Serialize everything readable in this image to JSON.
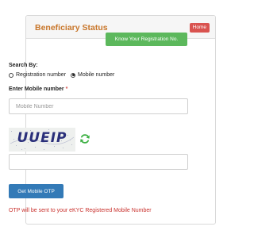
{
  "header": {
    "title": "Beneficiary Status",
    "home_label": "Home"
  },
  "know_registration_label": "Know Your Registration No.",
  "search_by": {
    "label": "Search By:",
    "options": [
      "Registration number",
      "Mobile number"
    ],
    "selected": "Mobile number"
  },
  "mobile": {
    "label": "Enter Mobile number",
    "required_mark": "*",
    "placeholder": "Mobile Number",
    "value": ""
  },
  "captcha": {
    "text": "UUEIP",
    "refresh_icon": "refresh-icon",
    "input_value": ""
  },
  "get_otp_label": "Get Mobile OTP",
  "otp_note": "OTP will be sent to your eKYC Registered Mobile Number",
  "colors": {
    "title": "#c8762a",
    "home": "#d9534f",
    "know_button": "#5cb85c",
    "otp_button": "#337ab7",
    "note": "#c9302c",
    "refresh": "#3cb043"
  }
}
